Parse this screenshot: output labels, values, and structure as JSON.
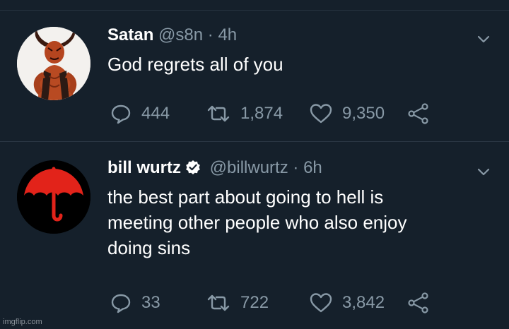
{
  "tweets": [
    {
      "name": "Satan",
      "handle": "@s8n",
      "separator": "·",
      "time": "4h",
      "verified": false,
      "text": "God regrets all of you",
      "avatar": "demon-avatar",
      "replies": "444",
      "retweets": "1,874",
      "likes": "9,350"
    },
    {
      "name": "bill wurtz",
      "handle": "@billwurtz",
      "separator": "·",
      "time": "6h",
      "verified": true,
      "text_lines": [
        "the best part about going to hell is",
        "meeting other people who also enjoy",
        "doing sins"
      ],
      "avatar": "red-umbrella-avatar",
      "replies": "33",
      "retweets": "722",
      "likes": "3,842"
    }
  ],
  "icons": {
    "reply": "reply-icon",
    "retweet": "retweet-icon",
    "like": "heart-icon",
    "share": "share-icon",
    "menu": "chevron-down-icon",
    "verified": "verified-badge-icon"
  },
  "colors": {
    "background": "#15202b",
    "muted": "#8899a6",
    "text": "#ffffff",
    "umbrella": "#e2231a"
  },
  "watermark": "imgflip.com"
}
